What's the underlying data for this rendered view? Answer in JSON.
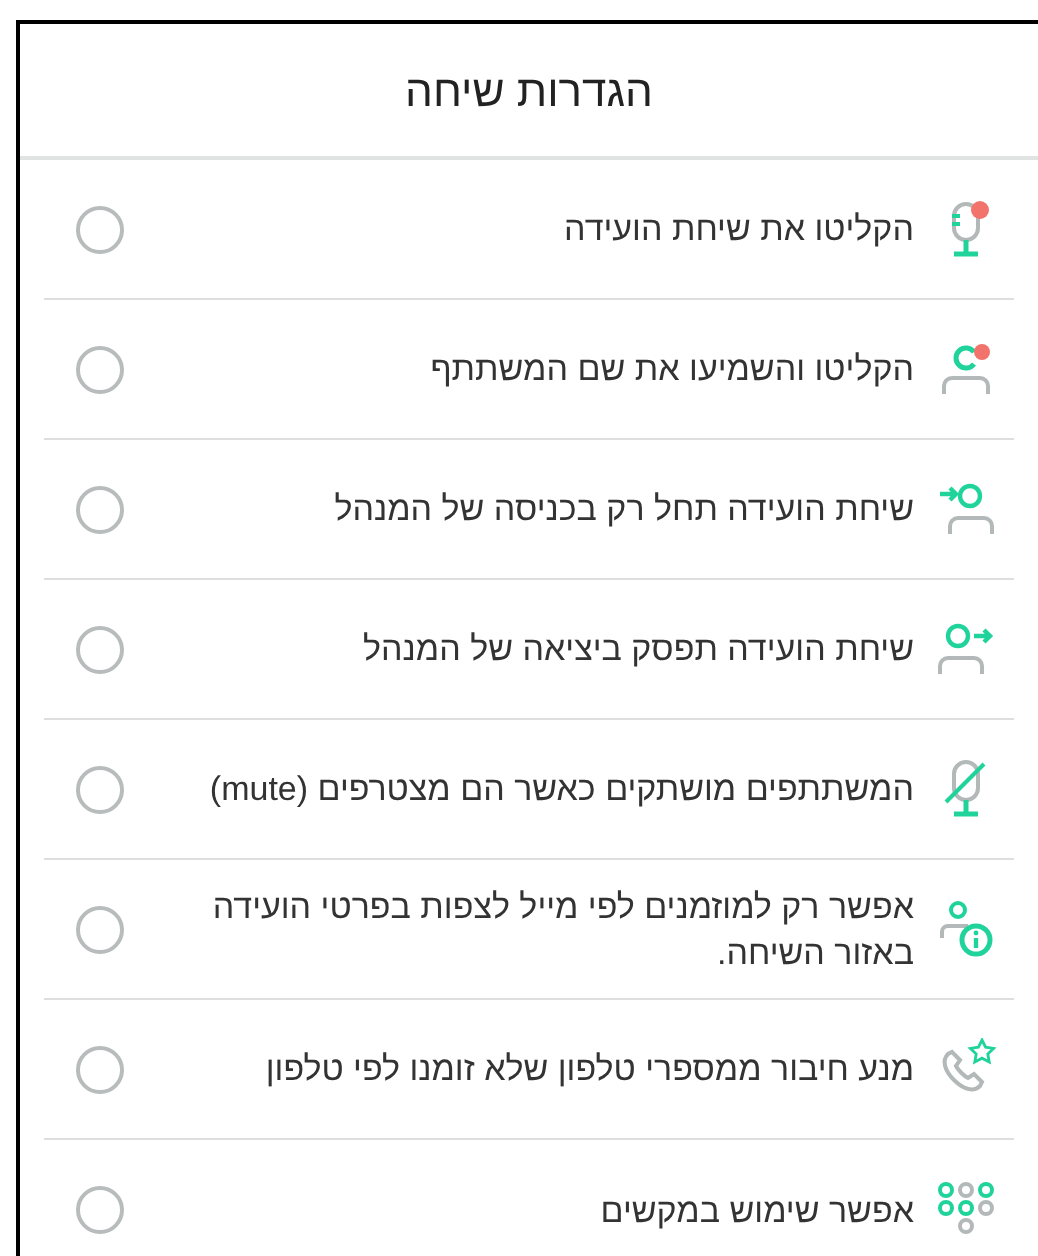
{
  "title": "הגדרות שיחה",
  "settings": [
    {
      "kind": "record-mic",
      "label": "הקליטו את שיחת הועידה",
      "checked": false
    },
    {
      "kind": "record-name",
      "label": "הקליטו והשמיעו את שם המשתתף",
      "checked": false
    },
    {
      "kind": "user-in",
      "label": "שיחת הועידה תחל רק בכניסה של המנהל",
      "checked": false
    },
    {
      "kind": "user-out",
      "label": "שיחת הועידה תפסק ביציאה של המנהל",
      "checked": false
    },
    {
      "kind": "mic-muted",
      "label": "המשתתפים מושתקים כאשר הם מצטרפים (mute)",
      "checked": false
    },
    {
      "kind": "user-info",
      "label": "אפשר רק למוזמנים לפי מייל לצפות בפרטי הועידה באזור השיחה.",
      "checked": false
    },
    {
      "kind": "phone-star",
      "label": "מנע חיבור ממספרי טלפון שלא זומנו לפי טלפון",
      "checked": false
    },
    {
      "kind": "dialpad",
      "label": "אפשר שימוש במקשים",
      "checked": false
    }
  ]
}
